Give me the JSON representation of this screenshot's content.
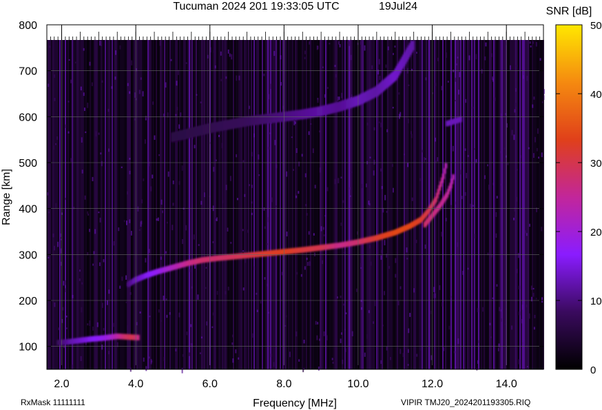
{
  "header": {
    "title": "Tucuman 2024 201 19:33:05 UTC",
    "date": "19Jul24"
  },
  "footer": {
    "rx_mask": "RxMask 11111111",
    "source_file": "VIPIR  TMJ20_2024201193305.RIQ"
  },
  "colorbar": {
    "label": "SNR [dB]",
    "ticks": [
      "0",
      "10",
      "20",
      "30",
      "40",
      "50"
    ],
    "min": 0,
    "max": 50
  },
  "chart_data": {
    "type": "heatmap",
    "title": "Tucuman 2024 201 19:33:05 UTC",
    "xlabel": "Frequency [MHz]",
    "ylabel": "Range [km]",
    "xlim": [
      1.6,
      15.0
    ],
    "ylim": [
      50,
      800
    ],
    "x_ticks": [
      2.0,
      4.0,
      6.0,
      8.0,
      10.0,
      12.0,
      14.0
    ],
    "x_tick_labels": [
      "2.0",
      "4.0",
      "6.0",
      "8.0",
      "10.0",
      "12.0",
      "14.0"
    ],
    "y_ticks": [
      100,
      200,
      300,
      400,
      500,
      600,
      700,
      800
    ],
    "y_tick_labels": [
      "100",
      "200",
      "300",
      "400",
      "500",
      "600",
      "700",
      "800"
    ],
    "grid": true,
    "colormap": [
      "#000000",
      "#3a0a5e",
      "#8a1cff",
      "#c2269a",
      "#e0401a",
      "#f58a10",
      "#ffe800"
    ],
    "series": [
      {
        "x": [
          1.9,
          2.2,
          2.5,
          2.8,
          3.1,
          3.3,
          3.5,
          3.7,
          3.9,
          4.1
        ],
        "y": [
          108,
          110,
          113,
          116,
          118,
          120,
          122,
          121,
          120,
          119
        ],
        "snr": [
          8,
          12,
          14,
          16,
          18,
          20,
          24,
          28,
          30,
          26
        ]
      },
      {
        "x": [
          3.8,
          4.0,
          4.3,
          4.6,
          5.0,
          5.4,
          5.8,
          6.2,
          6.6,
          7.0,
          7.5,
          8.0,
          8.5,
          9.0,
          9.5,
          10.0,
          10.5,
          11.0,
          11.4,
          11.7,
          11.9,
          12.1,
          12.2,
          12.3,
          12.4
        ],
        "y": [
          235,
          245,
          255,
          263,
          272,
          281,
          288,
          292,
          295,
          298,
          302,
          306,
          310,
          315,
          320,
          327,
          336,
          348,
          362,
          376,
          395,
          420,
          445,
          470,
          505
        ],
        "snr": [
          10,
          13,
          16,
          18,
          22,
          26,
          28,
          28,
          29,
          30,
          32,
          33,
          31,
          30,
          26,
          28,
          32,
          34,
          34,
          32,
          30,
          28,
          26,
          24,
          22
        ]
      },
      {
        "x": [
          11.8,
          12.0,
          12.2,
          12.4,
          12.5,
          12.6
        ],
        "y": [
          365,
          385,
          405,
          430,
          450,
          478
        ],
        "snr": [
          28,
          27,
          26,
          25,
          24,
          22
        ]
      },
      {
        "x": [
          5.0,
          6.0,
          7.0,
          8.0,
          8.5,
          9.0,
          9.5,
          10.0,
          10.5,
          11.0,
          11.5
        ],
        "y": [
          555,
          575,
          590,
          600,
          605,
          612,
          622,
          635,
          655,
          690,
          760
        ],
        "snr": [
          6,
          7,
          8,
          10,
          11,
          12,
          11,
          13,
          12,
          14,
          12
        ]
      },
      {
        "x": [
          12.4,
          12.8
        ],
        "y": [
          585,
          595
        ],
        "snr": [
          13,
          13
        ]
      }
    ]
  }
}
